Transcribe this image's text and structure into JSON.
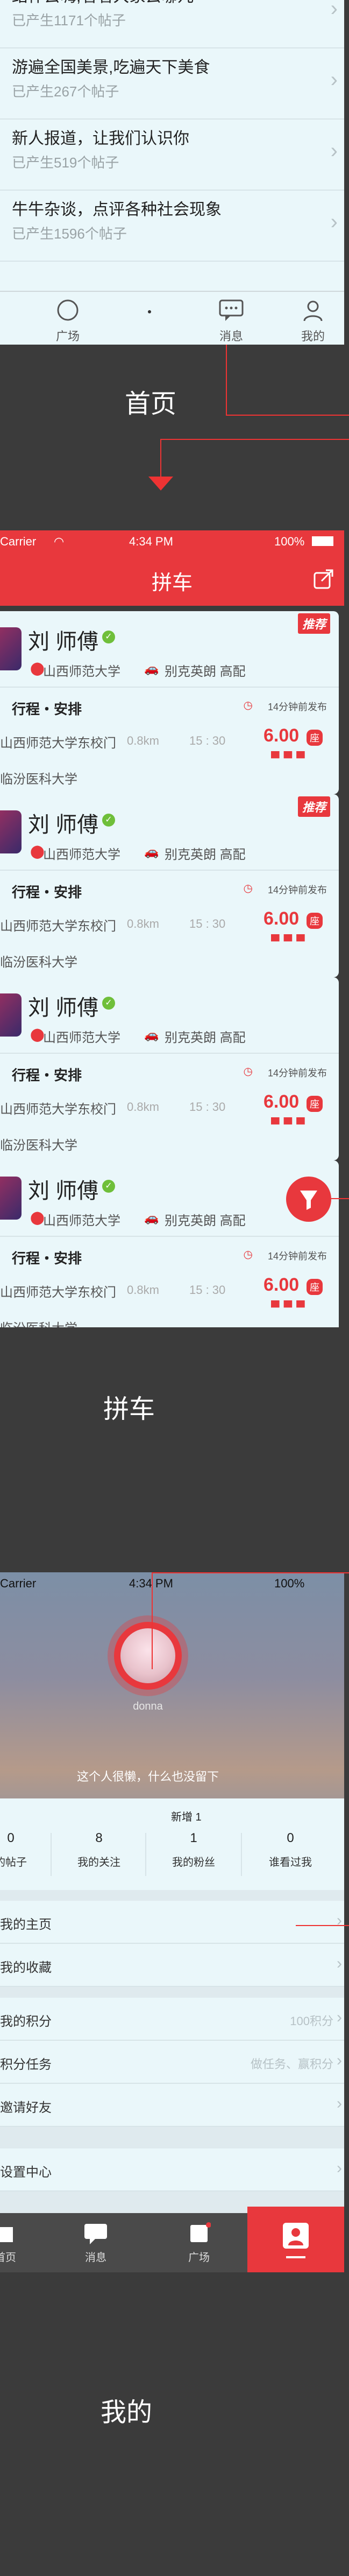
{
  "screen1": {
    "items": [
      {
        "title": "结伴去嗨,看看大家去哪儿",
        "count": "已产生1171个帖子"
      },
      {
        "title": "游遍全国美景,吃遍天下美食",
        "count": "已产生267个帖子"
      },
      {
        "title": "新人报道，让我们认识你",
        "count": "已产生519个帖子"
      },
      {
        "title": "牛牛杂谈，点评各种社会现象",
        "count": "已产生1596个帖子"
      }
    ],
    "tabs": [
      "广场",
      "消息",
      "我的"
    ],
    "caption": "首页"
  },
  "screen2": {
    "status": {
      "carrier": "Carrier",
      "time": "4:34 PM",
      "battery": "100%"
    },
    "title": "拼车",
    "cards": [
      {
        "name": "刘 师傅",
        "school": "山西师范大学",
        "car": "别克英朗 高配",
        "recommend": "推荐",
        "trip": "行程・安排",
        "published": "14分钟前发布",
        "from": "山西师范大学东校门",
        "dist": "0.8km",
        "time": "15 : 30",
        "to": "临汾医科大学",
        "price": "6.00",
        "unit": "座"
      },
      {
        "name": "刘 师傅",
        "school": "山西师范大学",
        "car": "别克英朗 高配",
        "recommend": "推荐",
        "trip": "行程・安排",
        "published": "14分钟前发布",
        "from": "山西师范大学东校门",
        "dist": "0.8km",
        "time": "15 : 30",
        "to": "临汾医科大学",
        "price": "6.00",
        "unit": "座"
      },
      {
        "name": "刘 师傅",
        "school": "山西师范大学",
        "car": "别克英朗 高配",
        "recommend": "",
        "trip": "行程・安排",
        "published": "14分钟前发布",
        "from": "山西师范大学东校门",
        "dist": "0.8km",
        "time": "15 : 30",
        "to": "临汾医科大学",
        "price": "6.00",
        "unit": "座"
      },
      {
        "name": "刘 师傅",
        "school": "山西师范大学",
        "car": "别克英朗 高配",
        "recommend": "",
        "trip": "行程・安排",
        "published": "14分钟前发布",
        "from": "山西师范大学东校门",
        "dist": "0.8km",
        "time": "15 : 30",
        "to": "临汾医科大学",
        "price": "6.00",
        "unit": "座"
      }
    ],
    "caption": "拼车"
  },
  "screen3": {
    "status": {
      "carrier": "Carrier",
      "time": "4:34 PM",
      "battery": "100%"
    },
    "username": "donna",
    "signature": "这个人很懒，什么也没留下",
    "new_fans": "新增 1",
    "stats": [
      {
        "n": "0",
        "l": "的帖子"
      },
      {
        "n": "8",
        "l": "我的关注"
      },
      {
        "n": "1",
        "l": "我的粉丝"
      },
      {
        "n": "0",
        "l": "谁看过我"
      }
    ],
    "rows": [
      {
        "label": "我的主页",
        "value": ""
      },
      {
        "label": "我的收藏",
        "value": ""
      },
      {
        "label": "我的积分",
        "value": "100积分"
      },
      {
        "label": "积分任务",
        "value": "做任务、赢积分"
      },
      {
        "label": "邀请好友",
        "value": ""
      },
      {
        "label": "设置中心",
        "value": ""
      }
    ],
    "tabs": [
      "首页",
      "消息",
      "广场"
    ],
    "caption": "我的"
  }
}
